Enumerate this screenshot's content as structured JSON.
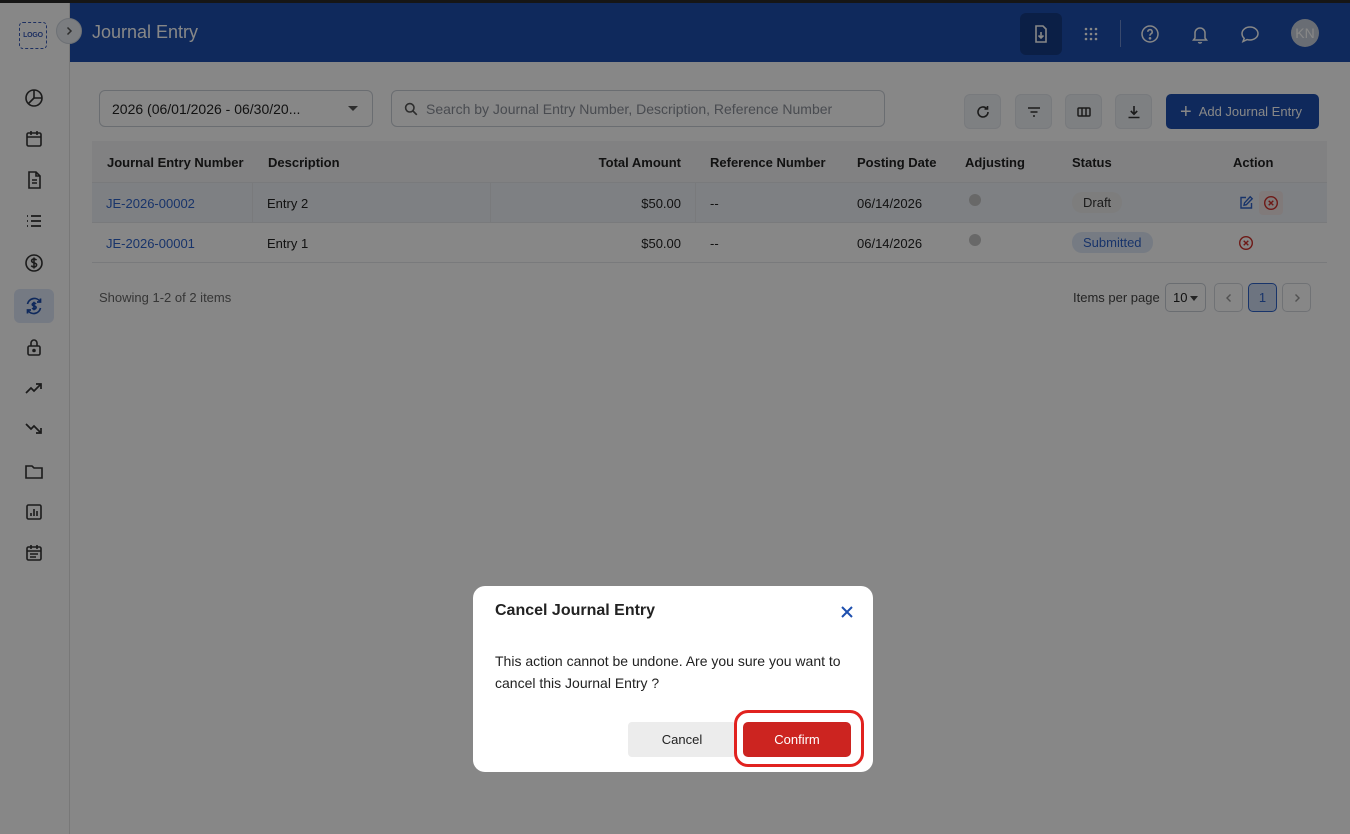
{
  "app": {
    "logo_text": "LOGO",
    "page_title": "Journal Entry",
    "avatar_initials": "KN"
  },
  "header_icons": [
    "import-icon",
    "apps-grid-icon",
    "help-icon",
    "bell-icon",
    "chat-icon"
  ],
  "sidebar": {
    "active_item": "sync-dollar-icon",
    "items": [
      "pie-chart-icon",
      "calendar-icon",
      "document-icon",
      "list-icon",
      "dollar-circle-icon",
      "sync-dollar-icon",
      "lock-icon",
      "trend-up-icon",
      "trend-down-icon",
      "folder-icon",
      "report-icon",
      "calendar-notes-icon"
    ]
  },
  "toolbar": {
    "fiscal_year_value": "2026 (06/01/2026 - 06/30/20...",
    "search_placeholder": "Search by Journal Entry Number, Description, Reference Number",
    "add_button_label": "Add Journal Entry",
    "icons": [
      "refresh-icon",
      "filter-icon",
      "columns-icon",
      "download-icon"
    ]
  },
  "table": {
    "columns": [
      "Journal Entry Number",
      "Description",
      "Total Amount",
      "Reference Number",
      "Posting Date",
      "Adjusting",
      "Status",
      "Action"
    ],
    "rows": [
      {
        "number": "JE-2026-00002",
        "description": "Entry 2",
        "total": "$50.00",
        "reference": "--",
        "posting_date": "06/14/2026",
        "status": "Draft"
      },
      {
        "number": "JE-2026-00001",
        "description": "Entry 1",
        "total": "$50.00",
        "reference": "--",
        "posting_date": "06/14/2026",
        "status": "Submitted"
      }
    ]
  },
  "pagination": {
    "showing": "Showing 1-2 of 2 items",
    "items_per_page_label": "Items per page",
    "items_per_page": "10",
    "current_page": "1"
  },
  "dialog": {
    "title": "Cancel Journal Entry",
    "message": "This action cannot be undone. Are you sure you want to cancel this Journal Entry ?",
    "cancel_label": "Cancel",
    "confirm_label": "Confirm"
  },
  "colors": {
    "header": "#1e4fae",
    "confirm": "#cc2420",
    "link": "#2f62c9"
  }
}
